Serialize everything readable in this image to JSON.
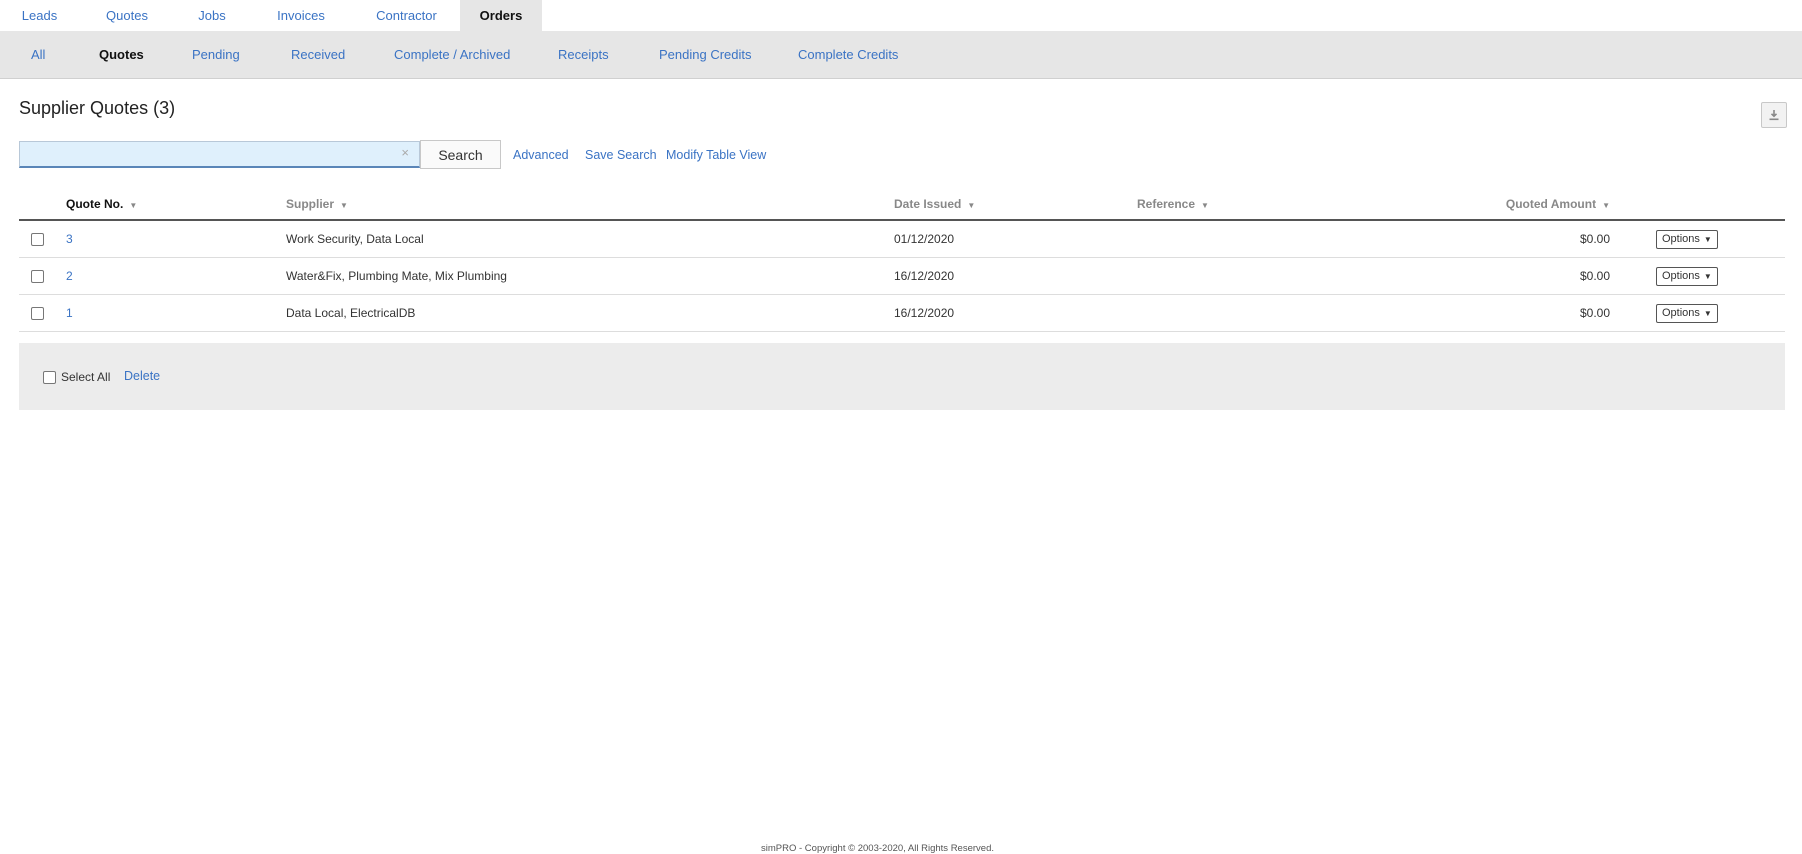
{
  "top_tabs": [
    {
      "label": "Leads"
    },
    {
      "label": "Quotes"
    },
    {
      "label": "Jobs"
    },
    {
      "label": "Invoices"
    },
    {
      "label": "Contractor"
    },
    {
      "label": "Orders",
      "active": true
    }
  ],
  "sub_tabs": [
    {
      "label": "All"
    },
    {
      "label": "Quotes",
      "active": true
    },
    {
      "label": "Pending"
    },
    {
      "label": "Received"
    },
    {
      "label": "Complete / Archived"
    },
    {
      "label": "Receipts"
    },
    {
      "label": "Pending Credits"
    },
    {
      "label": "Complete Credits"
    }
  ],
  "page": {
    "title": "Supplier Quotes (3)"
  },
  "export": {
    "icon": "download-icon"
  },
  "search": {
    "value": "",
    "clear": "×",
    "button": "Search"
  },
  "links": {
    "advanced": "Advanced",
    "save_search": "Save Search",
    "modify_table": "Modify Table View"
  },
  "table": {
    "headers": {
      "quote_no": "Quote No.",
      "supplier": "Supplier",
      "date_issued": "Date Issued",
      "reference": "Reference",
      "quoted_amount": "Quoted Amount"
    },
    "rows": [
      {
        "quote_no": "3",
        "supplier": "Work Security, Data Local",
        "date_issued": "01/12/2020",
        "reference": "",
        "quoted_amount": "$0.00",
        "options": "Options"
      },
      {
        "quote_no": "2",
        "supplier": "Water&Fix, Plumbing Mate, Mix Plumbing",
        "date_issued": "16/12/2020",
        "reference": "",
        "quoted_amount": "$0.00",
        "options": "Options"
      },
      {
        "quote_no": "1",
        "supplier": "Data Local, ElectricalDB",
        "date_issued": "16/12/2020",
        "reference": "",
        "quoted_amount": "$0.00",
        "options": "Options"
      }
    ]
  },
  "footer_bar": {
    "select_all": "Select All",
    "delete": "Delete"
  },
  "copyright": "simPRO - Copyright © 2003-2020, All Rights Reserved.",
  "colors": {
    "link": "#3a73c4",
    "tab_bar": "#e6e6e6",
    "search_bg": "#dff0fc"
  }
}
